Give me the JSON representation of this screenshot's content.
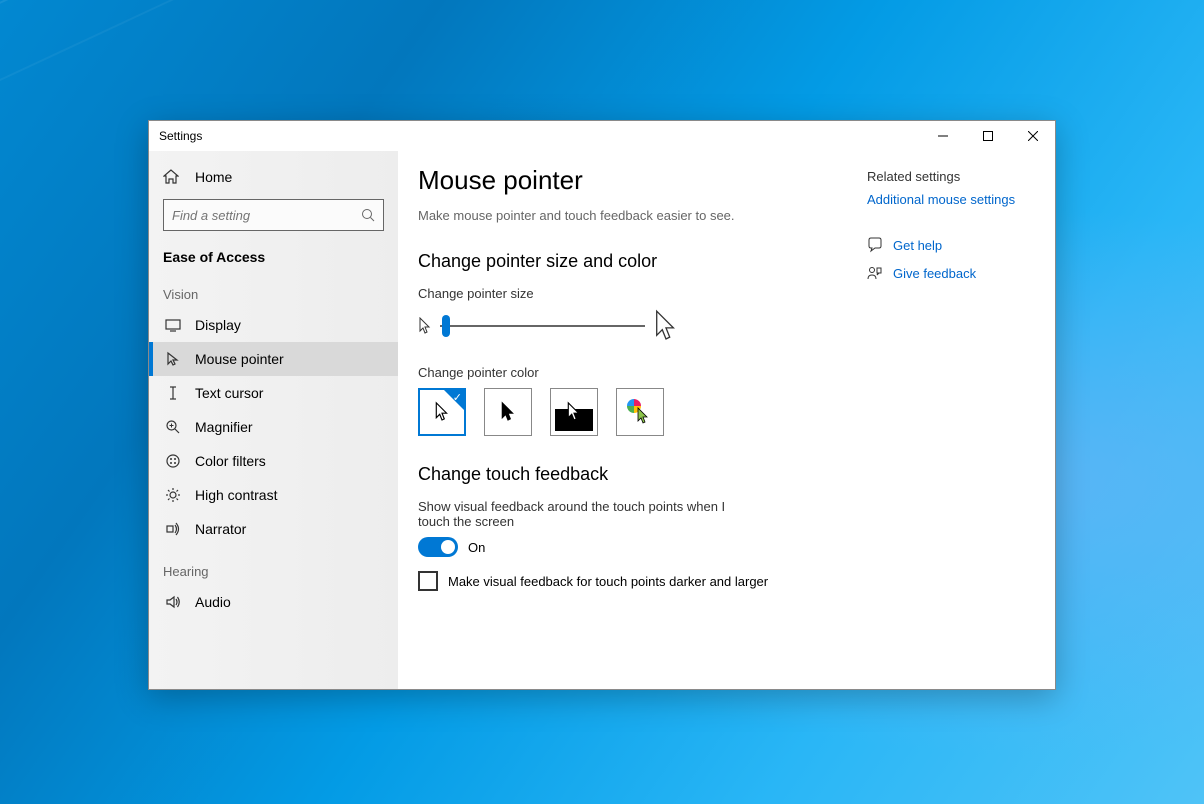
{
  "window": {
    "title": "Settings"
  },
  "sidebar": {
    "home": "Home",
    "search_placeholder": "Find a setting",
    "category": "Ease of Access",
    "groups": {
      "vision": "Vision",
      "hearing": "Hearing"
    },
    "items": {
      "display": "Display",
      "mouse_pointer": "Mouse pointer",
      "text_cursor": "Text cursor",
      "magnifier": "Magnifier",
      "color_filters": "Color filters",
      "high_contrast": "High contrast",
      "narrator": "Narrator",
      "audio": "Audio"
    }
  },
  "page": {
    "title": "Mouse pointer",
    "description": "Make mouse pointer and touch feedback easier to see."
  },
  "pointer_section": {
    "title": "Change pointer size and color",
    "size_label": "Change pointer size",
    "color_label": "Change pointer color"
  },
  "touch_section": {
    "title": "Change touch feedback",
    "desc": "Show visual feedback around the touch points when I touch the screen",
    "toggle_state": "On",
    "checkbox_label": "Make visual feedback for touch points darker and larger"
  },
  "related": {
    "title": "Related settings",
    "link": "Additional mouse settings",
    "help": "Get help",
    "feedback": "Give feedback"
  }
}
